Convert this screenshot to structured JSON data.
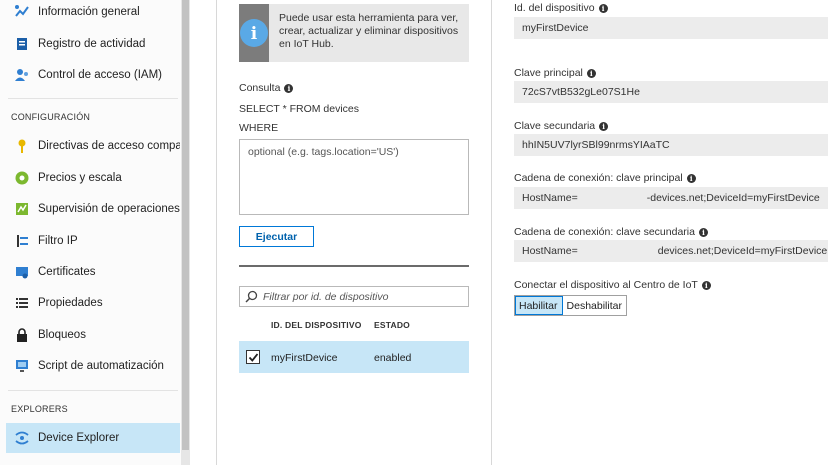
{
  "sidebar": {
    "items": [
      {
        "label": "Información general",
        "icon": "overview-icon"
      },
      {
        "label": "Registro de actividad",
        "icon": "activity-log-icon"
      },
      {
        "label": "Control de acceso (IAM)",
        "icon": "access-control-icon"
      },
      {
        "label": "Directivas de acceso compar...",
        "icon": "key-icon"
      },
      {
        "label": "Precios y escala",
        "icon": "pricing-icon"
      },
      {
        "label": "Supervisión de operaciones",
        "icon": "monitoring-icon"
      },
      {
        "label": "Filtro IP",
        "icon": "ip-filter-icon"
      },
      {
        "label": "Certificates",
        "icon": "certificate-icon"
      },
      {
        "label": "Propiedades",
        "icon": "properties-icon"
      },
      {
        "label": "Bloqueos",
        "icon": "lock-icon"
      },
      {
        "label": "Script de automatización",
        "icon": "automation-script-icon"
      },
      {
        "label": "Device Explorer",
        "icon": "device-explorer-icon"
      }
    ],
    "sections": {
      "configuracion": "CONFIGURACIÓN",
      "explorers": "EXPLORERS"
    },
    "active_item": "Device Explorer"
  },
  "explorer": {
    "info_text": "Puede usar esta herramienta para ver, crear, actualizar y eliminar dispositivos en IoT Hub.",
    "query_label": "Consulta",
    "query_line1": "SELECT * FROM devices",
    "query_line2": "WHERE",
    "where_placeholder": "optional (e.g. tags.location='US')",
    "run_button": "Ejecutar",
    "filter_placeholder": "Filtrar por id. de dispositivo",
    "columns": {
      "device_id": "ID. DEL DISPOSITIVO",
      "status": "ESTADO"
    },
    "rows": [
      {
        "device_id": "myFirstDevice",
        "status": "enabled",
        "checked": true
      }
    ]
  },
  "details": {
    "device_id_label": "Id. del dispositivo",
    "device_id_value": "myFirstDevice",
    "primary_key_label": "Clave principal",
    "primary_key_value": "72cS7vtB532gLe07S1He",
    "secondary_key_label": "Clave secundaria",
    "secondary_key_value": "hhIN5UV7lyrSBl99nrmsYIAaTC",
    "primary_conn_label": "Cadena de conexión: clave principal",
    "primary_conn_prefix": "HostName=",
    "primary_conn_suffix": "-devices.net;DeviceId=myFirstDevice",
    "secondary_conn_label": "Cadena de conexión: clave secundaria",
    "secondary_conn_prefix": "HostName=",
    "secondary_conn_suffix": "devices.net;DeviceId=myFirstDevice",
    "connect_label": "Conectar el dispositivo al Centro de IoT",
    "enable": "Habilitar",
    "disable": "Deshabilitar",
    "connect_state": "Habilitar"
  },
  "info_glyph": "i",
  "colors": {
    "accent": "#0078d7",
    "selected_bg": "#c7e6f7"
  }
}
